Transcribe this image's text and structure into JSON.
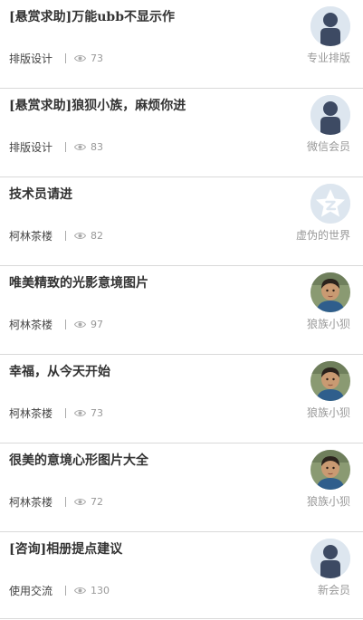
{
  "posts": [
    {
      "title": "[悬赏求助]万能ubb不显示作",
      "category": "排版设计",
      "views": "73",
      "author": "专业排版",
      "avatar": "default-avatar-icon"
    },
    {
      "title": "[悬赏求助]狼狈小族，麻烦你进",
      "category": "排版设计",
      "views": "83",
      "author": "微信会员",
      "avatar": "default-avatar-icon"
    },
    {
      "title": "技术员请进",
      "category": "柯林茶楼",
      "views": "82",
      "author": "虚伪的世界",
      "avatar": "qzone-star-icon"
    },
    {
      "title": "唯美精致的光影意境图片",
      "category": "柯林茶楼",
      "views": "97",
      "author": "狼族小狈",
      "avatar": "child-photo"
    },
    {
      "title": "幸福，从今天开始",
      "category": "柯林茶楼",
      "views": "73",
      "author": "狼族小狈",
      "avatar": "child-photo"
    },
    {
      "title": "很美的意境心形图片大全",
      "category": "柯林茶楼",
      "views": "72",
      "author": "狼族小狈",
      "avatar": "child-photo"
    },
    {
      "title": "[咨询]相册提点建议",
      "category": "使用交流",
      "views": "130",
      "author": "新会员",
      "avatar": "default-avatar-icon"
    }
  ],
  "colors": {
    "title": "#333333",
    "meta": "#999999",
    "divider": "#d9d9d9",
    "avatar_bg": "#dde6ef",
    "avatar_silhouette": "#3d4a63"
  }
}
